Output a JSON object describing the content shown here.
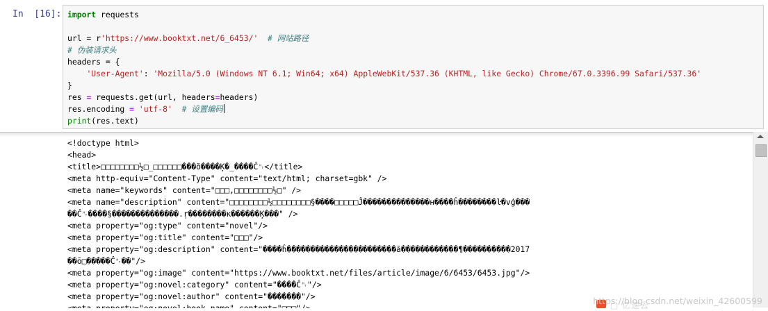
{
  "cell": {
    "prompt": "In  [16]:",
    "code": {
      "line1_kw": "import",
      "line1_rest": " requests",
      "line3_pre": "url = r",
      "line3_str": "'https://www.booktxt.net/6_6453/'",
      "line3_comment": "  # 网站路径",
      "line4_comment": "# 伪装请求头",
      "line5": "headers = {",
      "line6_key": "'User-Agent'",
      "line6_sep": ": ",
      "line6_val": "'Mozilla/5.0 (Windows NT 6.1; Win64; x64) AppleWebKit/537.36 (KHTML, like Gecko) Chrome/67.0.3396.99 Safari/537.36'",
      "line7": "}",
      "line8_a": "res ",
      "line8_op": "=",
      "line8_b": " requests.get(url, headers",
      "line8_op2": "=",
      "line8_c": "headers)",
      "line9_a": "res.encoding ",
      "line9_op": "=",
      "line9_sp": " ",
      "line9_str": "'utf-8'",
      "line9_comment": "  # 设置编码",
      "line10_fn": "print",
      "line10_rest": "(res.text)"
    }
  },
  "output": {
    "lines": [
      "<!doctype html>",
      "<head>",
      "<title>□□□□□□□□½□_□□□□□□���õ����Ķ�_����Ĉ␉</title>",
      "<meta http-equiv=\"Content-Type\" content=\"text/html; charset=gbk\" />",
      "<meta name=\"keywords\" content=\"□□□,□□□□□□□□½□\" />",
      "<meta name=\"description\" content=\"□□□□□□□□½□□□□□□□□§����□□□□□Ĵ��������������н����ĥ��������ŀ�vģ���",
      "��Ĉ␉����§��������������.̜r��������ĸ������Ķ���\" />",
      "<meta property=\"og:type\" content=\"novel\"/>",
      "<meta property=\"og:title\" content=\"□□□\"/>",
      "<meta property=\"og:description\" content=\"����ĥ�����������������������ā������������¶����������2017",
      "��ō□�����Ĉ␉��\"/>",
      "<meta property=\"og:image\" content=\"https://www.booktxt.net/files/article/image/6/6453/6453.jpg\"/>",
      "<meta property=\"og:novel:category\" content=\"����Ĉ␉\"/>",
      "<meta property=\"og:novel:author\" content=\"�������\"/>",
      "<meta property=\"og:novel:book_name\" content=\"□□□\"/>"
    ]
  },
  "watermark": {
    "text": "https://blog.csdn.net/weixin_42600599",
    "cn": "□ 亿速云"
  },
  "colors": {
    "prompt": "#303f9f",
    "keyword": "#008000",
    "string": "#ba2121",
    "comment": "#408080"
  }
}
